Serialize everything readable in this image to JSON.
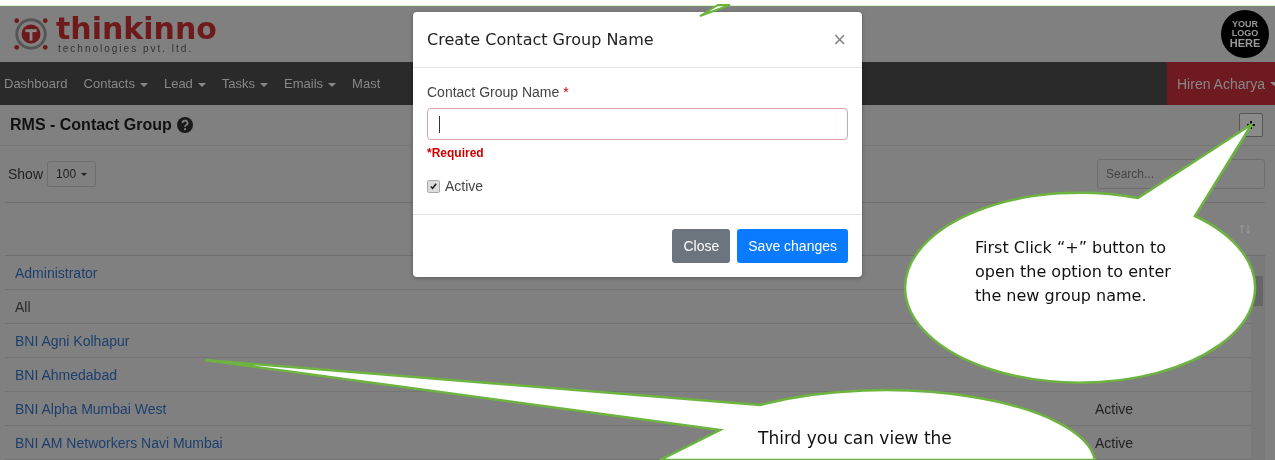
{
  "header": {
    "brand": "thinkinno",
    "tagline": "technologies pvt. ltd.",
    "client_logo": [
      "YOUR",
      "LOGO",
      "HERE"
    ]
  },
  "nav": {
    "items": [
      {
        "label": "Dashboard",
        "dropdown": false
      },
      {
        "label": "Contacts",
        "dropdown": true
      },
      {
        "label": "Lead",
        "dropdown": true
      },
      {
        "label": "Tasks",
        "dropdown": true
      },
      {
        "label": "Emails",
        "dropdown": true
      },
      {
        "label": "Mast",
        "dropdown": false
      }
    ],
    "user": "Hiren Acharya"
  },
  "page_title": "RMS - Contact Group",
  "show": {
    "label": "Show",
    "value": "100"
  },
  "search": {
    "placeholder": "Search..."
  },
  "rows": [
    {
      "name": "Administrator",
      "link": true
    },
    {
      "name": "All",
      "link": false
    },
    {
      "name": "BNI Agni Kolhapur",
      "link": true
    },
    {
      "name": "BNI Ahmedabad",
      "link": true
    },
    {
      "name": "BNI Alpha Mumbai West",
      "link": true,
      "status": "Active"
    },
    {
      "name": "BNI AM Networkers Navi Mumbai",
      "link": true,
      "status": "Active"
    }
  ],
  "modal": {
    "title": "Create Contact Group Name",
    "close": "×",
    "field_label": "Contact Group Name",
    "required_mark": "*",
    "error": "*Required",
    "checkbox": {
      "label": "Active",
      "checked": true
    },
    "buttons": [
      {
        "label": "Close",
        "kind": "secondary"
      },
      {
        "label": "Save changes",
        "kind": "primary"
      }
    ]
  },
  "callouts": [
    {
      "text": "First Click “+” button to open the option to enter the new group name."
    },
    {
      "text": "Third you can view the"
    }
  ]
}
